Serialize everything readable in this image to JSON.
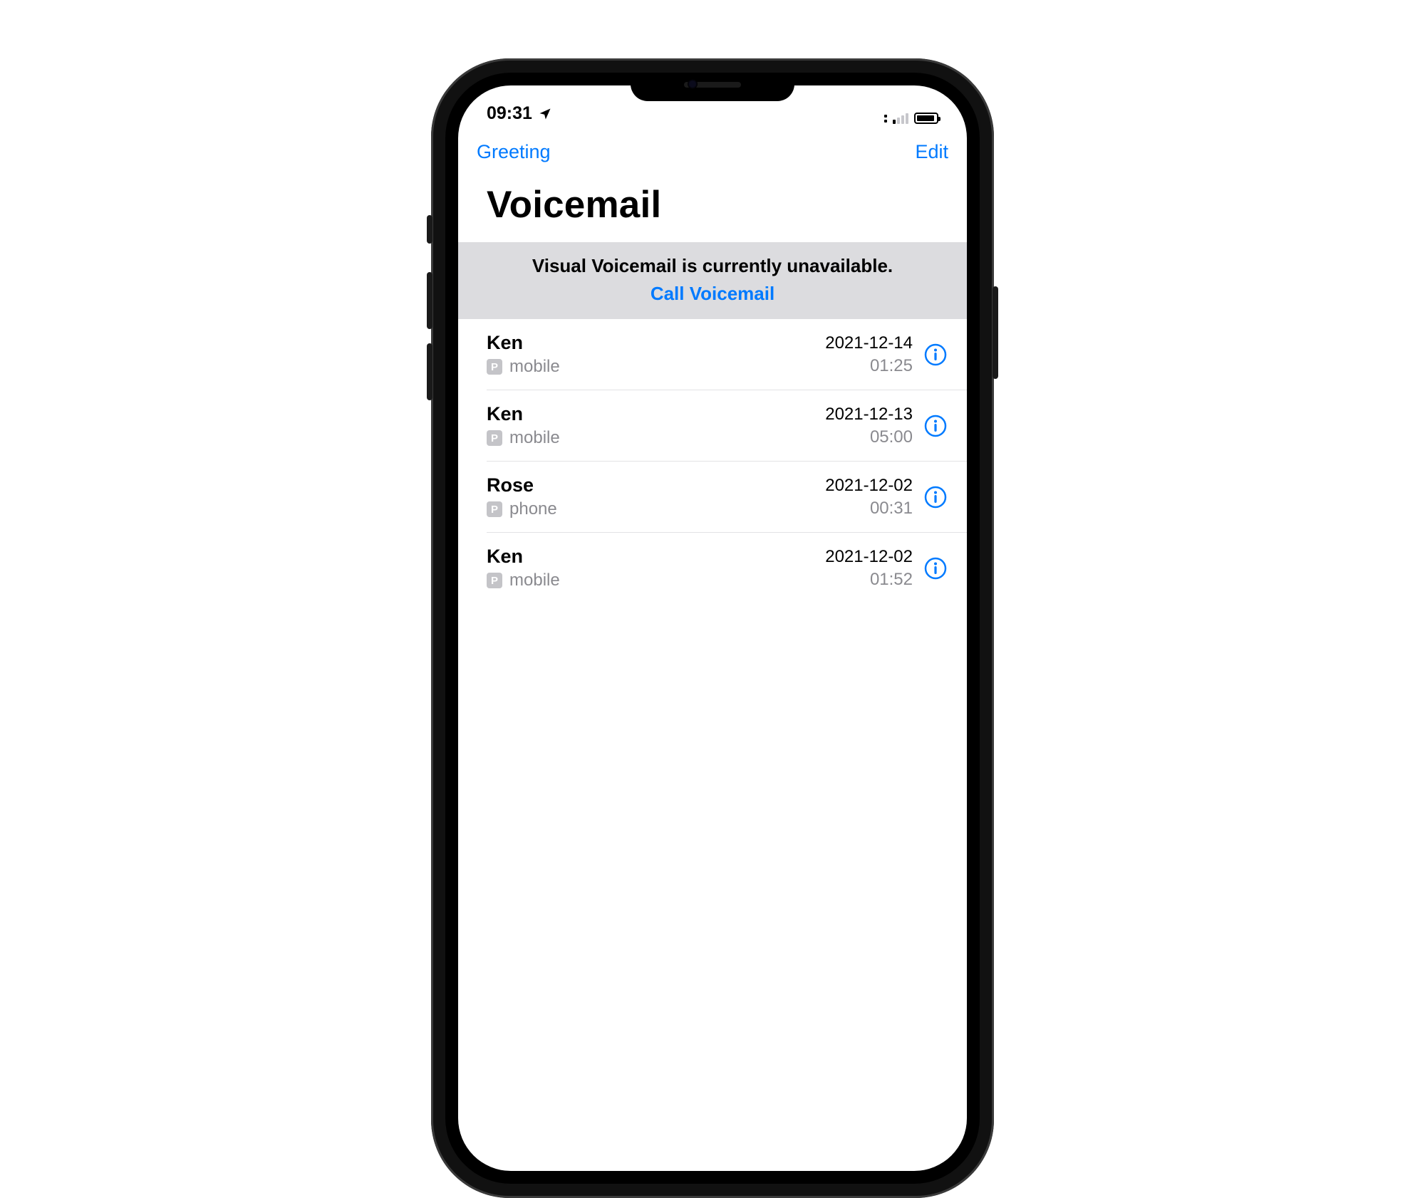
{
  "status": {
    "time": "09:31"
  },
  "nav": {
    "greeting": "Greeting",
    "edit": "Edit"
  },
  "title": "Voicemail",
  "banner": {
    "message": "Visual Voicemail is currently unavailable.",
    "link": "Call Voicemail"
  },
  "badge_letter": "P",
  "rows": [
    {
      "name": "Ken",
      "label": "mobile",
      "date": "2021-12-14",
      "duration": "01:25"
    },
    {
      "name": "Ken",
      "label": "mobile",
      "date": "2021-12-13",
      "duration": "05:00"
    },
    {
      "name": "Rose",
      "label": "phone",
      "date": "2021-12-02",
      "duration": "00:31"
    },
    {
      "name": "Ken",
      "label": "mobile",
      "date": "2021-12-02",
      "duration": "01:52"
    }
  ],
  "colors": {
    "tint": "#007aff",
    "secondary": "#8a8a8f",
    "banner_bg": "#dcdcdf"
  }
}
